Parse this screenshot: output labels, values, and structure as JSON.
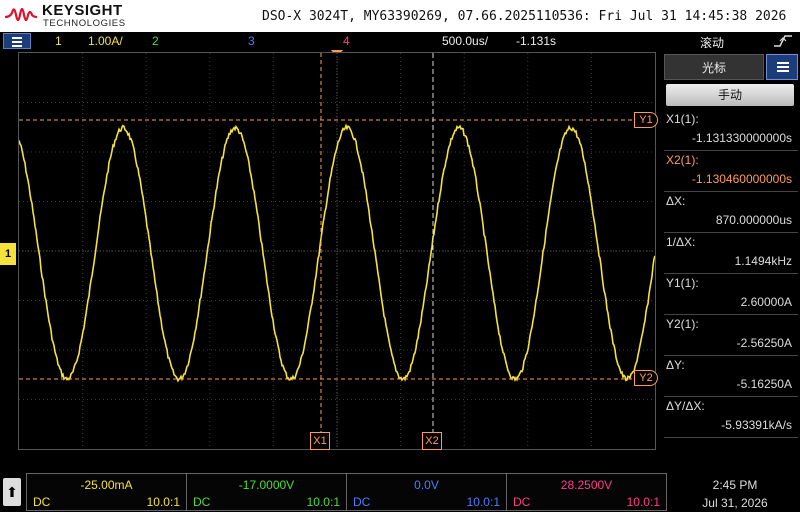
{
  "header": {
    "brand_name": "KEYSIGHT",
    "brand_sub": "TECHNOLOGIES",
    "device_info": "DSO-X 3024T, MY63390269, 07.66.2025110536: Fri Jul 31 14:45:38 2026"
  },
  "channel_bar": {
    "ch1_num": "1",
    "ch1_scale": "1.00A/",
    "ch2_num": "2",
    "ch3_num": "3",
    "ch4_num": "4",
    "timebase": "500.0us/",
    "delay": "-1.131s",
    "mode": "滚动",
    "trigger_icon": "trigger-edge-icon"
  },
  "screen": {
    "cursor_x1_label": "X1",
    "cursor_x2_label": "X2",
    "cursor_y1_label": "Y1",
    "cursor_y2_label": "Y2",
    "ch1_ground_label": "1"
  },
  "side_panel": {
    "tab_label": "光标",
    "mode_button": "手动",
    "readouts": [
      {
        "label": "X1(1):",
        "value": "-1.131330000000s",
        "color": "#dddddd"
      },
      {
        "label": "X2(1):",
        "value": "-1.130460000000s",
        "color": "#ff9c5a"
      },
      {
        "label": "ΔX:",
        "value": "870.000000us",
        "color": "#dddddd"
      },
      {
        "label": "1/ΔX:",
        "value": "1.1494kHz",
        "color": "#dddddd"
      },
      {
        "label": "Y1(1):",
        "value": "2.60000A",
        "color": "#dddddd"
      },
      {
        "label": "Y2(1):",
        "value": "-2.56250A",
        "color": "#dddddd"
      },
      {
        "label": "ΔY:",
        "value": "-5.16250A",
        "color": "#dddddd"
      },
      {
        "label": "ΔY/ΔX:",
        "value": "-5.93391kA/s",
        "color": "#dddddd"
      }
    ]
  },
  "bottom_bar": {
    "channels": [
      {
        "offset": "-25.00mA",
        "coupling": "DC",
        "probe": "10.0:1",
        "color": "#f5e33b"
      },
      {
        "offset": "-17.0000V",
        "coupling": "DC",
        "probe": "10.0:1",
        "color": "#4ddc3c"
      },
      {
        "offset": "0.0V",
        "coupling": "DC",
        "probe": "10.0:1",
        "color": "#4d7dff"
      },
      {
        "offset": "28.2500V",
        "coupling": "DC",
        "probe": "10.0:1",
        "color": "#ff3d8b"
      }
    ],
    "time": "2:45 PM",
    "date": "Jul 31, 2026"
  },
  "colors": {
    "ch1": "#f5e33b",
    "ch2": "#4ddc3c",
    "ch3": "#4d7dff",
    "ch4": "#ff3d8b",
    "cursor": "#ff9c5a"
  },
  "waveform": {
    "channel": 1,
    "shape": "sine",
    "cycles_visible": 5.7,
    "frequency": "1.1494kHz",
    "peak": "2.60000A",
    "trough": "-2.56250A"
  }
}
